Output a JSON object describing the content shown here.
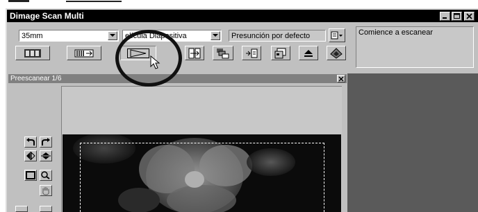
{
  "window": {
    "title": "Dimage Scan Multi"
  },
  "title_buttons": [
    {
      "name": "minimize-button",
      "glyph": "▁"
    },
    {
      "name": "maximize-button",
      "glyph": "□"
    },
    {
      "name": "close-button",
      "glyph": "✕"
    }
  ],
  "settings": {
    "film_format": "35mm",
    "film_type": "elícula Diapositiva",
    "preset": "Presunción por defecto"
  },
  "status": {
    "message": "Comience a escanear"
  },
  "toolbar": {
    "buttons": [
      {
        "name": "index-scan-icon"
      },
      {
        "name": "prescan-icon"
      },
      {
        "name": "scan-icon"
      },
      {
        "name": "image-correction-icon"
      },
      {
        "name": "batch-scan-icon"
      },
      {
        "name": "save-icon"
      },
      {
        "name": "preferences-icon"
      },
      {
        "name": "eject-icon"
      },
      {
        "name": "help-icon"
      }
    ]
  },
  "preview": {
    "title": "Preescanear  1/6"
  },
  "tools": [
    {
      "name": "rotate-left-icon"
    },
    {
      "name": "rotate-right-icon"
    },
    {
      "name": "flip-horizontal-icon"
    },
    {
      "name": "flip-vertical-icon"
    },
    {
      "name": "crop-icon"
    },
    {
      "name": "zoom-icon"
    },
    {
      "name": "hand-pan-icon"
    }
  ],
  "colors": {
    "titlebar": "#000000",
    "panel": "#c0c0c0",
    "dark_panel": "#5a5a5a",
    "photo": "#0b0b0b"
  }
}
